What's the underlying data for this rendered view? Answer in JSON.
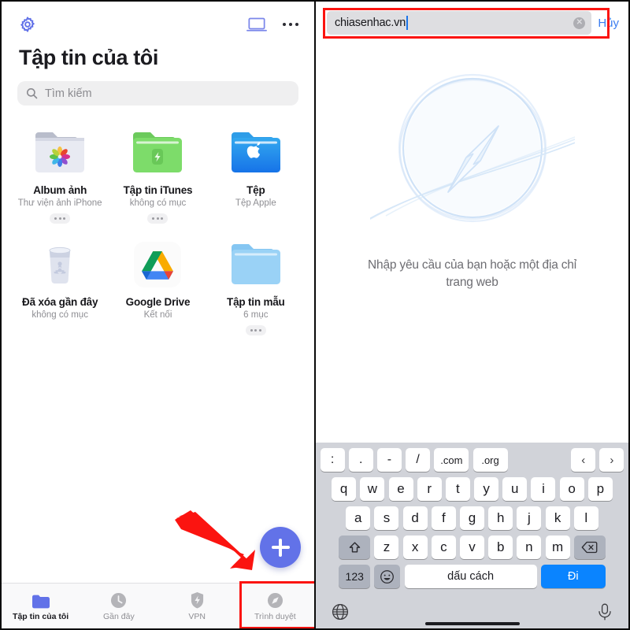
{
  "left": {
    "header": {
      "gear_icon": "gear-icon",
      "laptop_icon": "laptop-icon",
      "more_icon": "more-horizontal-icon"
    },
    "title": "Tập tin của tôi",
    "search": {
      "placeholder": "Tìm kiếm",
      "icon": "search-icon"
    },
    "folders": [
      {
        "name": "Album ảnh",
        "sub": "Thư viện ảnh iPhone",
        "icon": "photos-folder-icon",
        "has_more": true
      },
      {
        "name": "Tập tin iTunes",
        "sub": "không có mục",
        "icon": "itunes-folder-icon",
        "has_more": true
      },
      {
        "name": "Tệp",
        "sub": "Tệp Apple",
        "icon": "apple-folder-icon",
        "has_more": false
      },
      {
        "name": "Đã xóa gần đây",
        "sub": "không có mục",
        "icon": "trash-icon",
        "has_more": false
      },
      {
        "name": "Google Drive",
        "sub": "Kết nối",
        "icon": "google-drive-icon",
        "has_more": false
      },
      {
        "name": "Tập tin mẫu",
        "sub": "6 mục",
        "icon": "blue-folder-icon",
        "has_more": true
      }
    ],
    "fab": {
      "label": "+",
      "icon": "plus-icon",
      "color": "#6272e8"
    },
    "tabs": [
      {
        "label": "Tập tin của tôi",
        "icon": "folder-icon",
        "active": true
      },
      {
        "label": "Gần đây",
        "icon": "clock-icon",
        "active": false
      },
      {
        "label": "VPN",
        "icon": "shield-bolt-icon",
        "active": false
      },
      {
        "label": "Trình duyệt",
        "icon": "compass-icon",
        "active": false
      }
    ],
    "annotations": {
      "arrow_color": "#fb1410",
      "highlight_color": "#fb1410"
    }
  },
  "right": {
    "address_bar": {
      "value": "chiasenhac.vn",
      "clear_icon": "clear-circle-icon",
      "cancel_label": "Hủy"
    },
    "start_page": {
      "logo": "safari-compass-icon",
      "message": "Nhập yêu cầu của bạn hoặc một địa chỉ trang web"
    },
    "keyboard": {
      "symbol_row": [
        ":",
        ".",
        "-",
        "/",
        ".com",
        ".org"
      ],
      "nav_keys": [
        "‹",
        "›"
      ],
      "row1": [
        "q",
        "w",
        "e",
        "r",
        "t",
        "y",
        "u",
        "i",
        "o",
        "p"
      ],
      "row2": [
        "a",
        "s",
        "d",
        "f",
        "g",
        "h",
        "j",
        "k",
        "l"
      ],
      "row3": [
        "z",
        "x",
        "c",
        "v",
        "b",
        "n",
        "m"
      ],
      "shift_icon": "shift-icon",
      "delete_icon": "backspace-icon",
      "numbers_label": "123",
      "emoji_icon": "emoji-icon",
      "space_label": "dấu cách",
      "go_label": "Đi",
      "globe_icon": "globe-icon",
      "mic_icon": "microphone-icon"
    }
  }
}
